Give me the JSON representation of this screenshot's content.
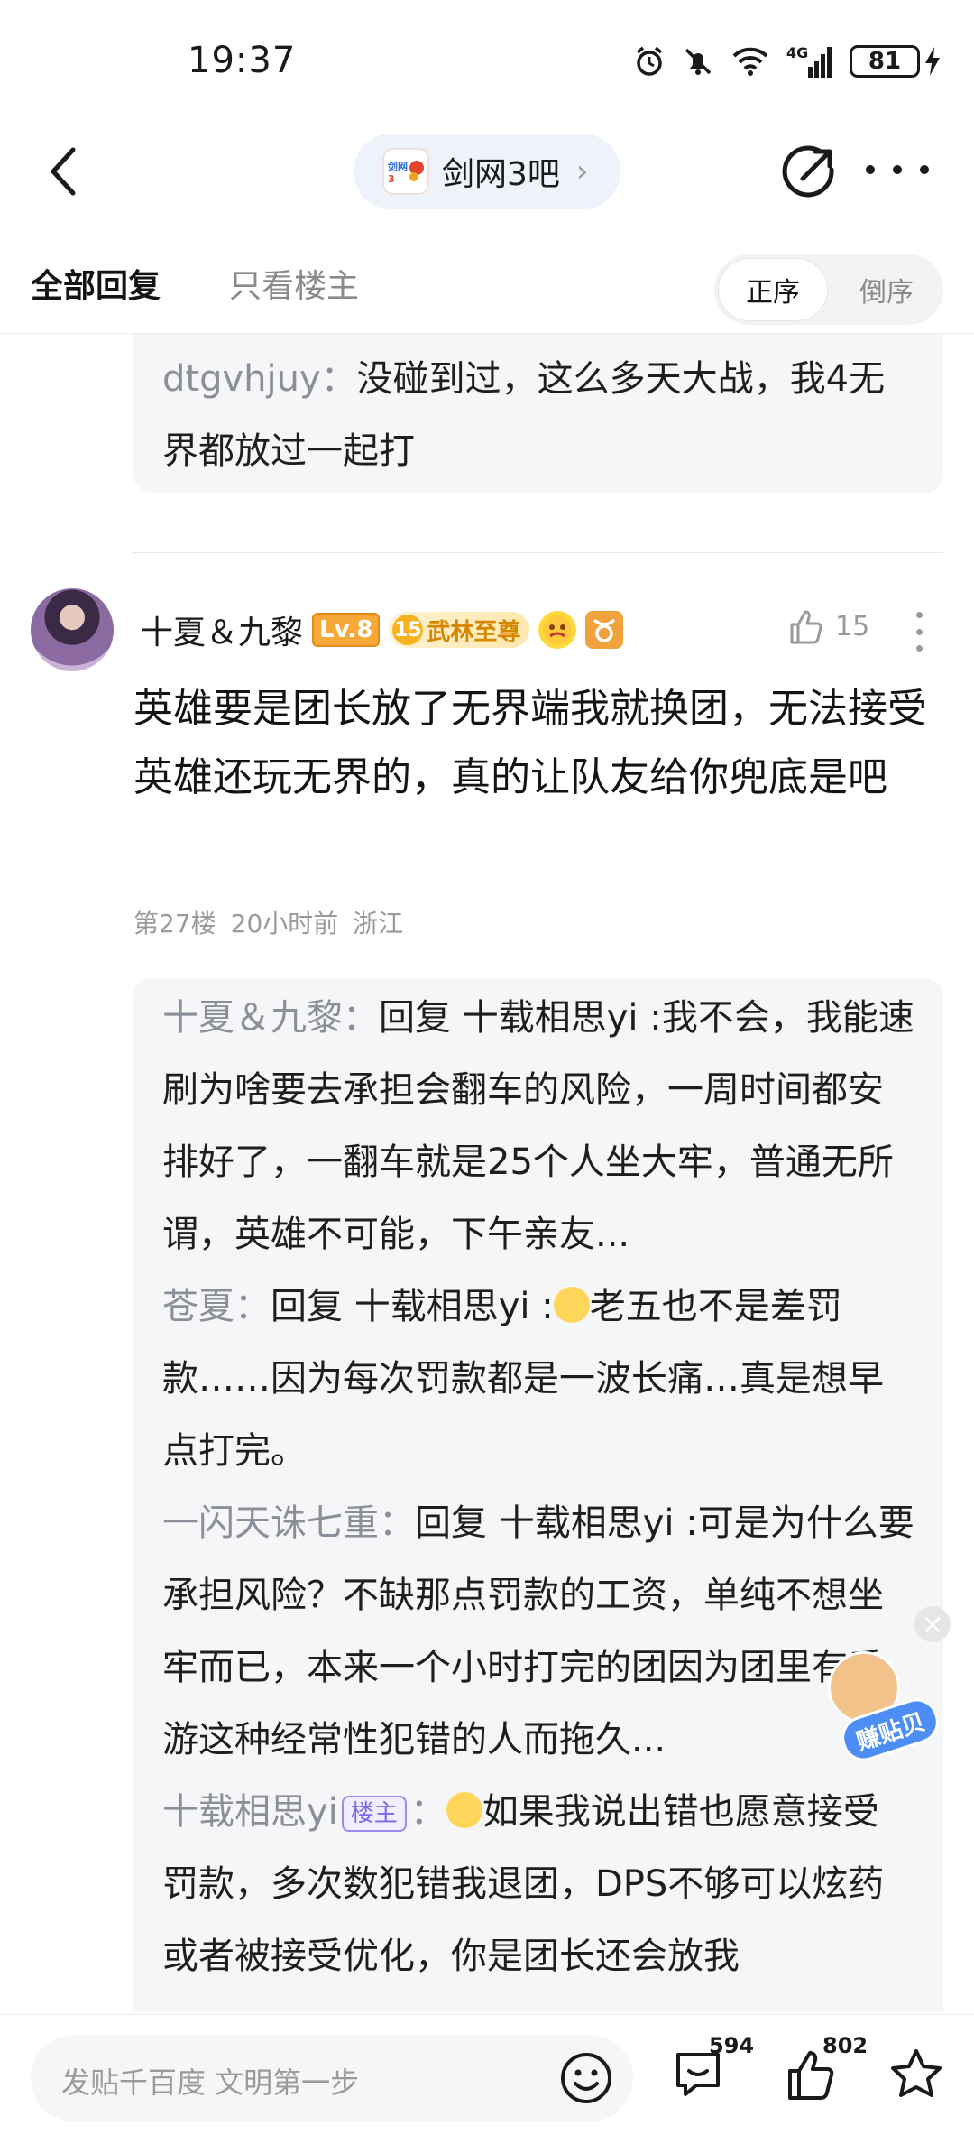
{
  "status_bar": {
    "time": "19:37",
    "network": "4G",
    "battery": "81"
  },
  "nav": {
    "forum_name": "剑网3吧",
    "forum_chevron": "›"
  },
  "tabs": {
    "all_replies": "全部回复",
    "op_only": "只看楼主",
    "order_asc": "正序",
    "order_desc": "倒序"
  },
  "prev_quote": {
    "username": "dtgvhjuy",
    "separator": "：",
    "text": "没碰到过，这么多天大战，我4无界都放过一起打"
  },
  "post": {
    "author": "十夏＆九黎",
    "level": "Lv.8",
    "title_badge_num": "15",
    "title_badge": "武林至尊",
    "like_count": "15",
    "body": "英雄要是团长放了无界端我就换团，无法接受英雄还玩无界的，真的让队友给你兜底是吧",
    "floor": "第27楼",
    "time": "20小时前",
    "location": "浙江"
  },
  "replies": [
    {
      "username": "十夏＆九黎",
      "sep": "：",
      "text": "回复 十载相思yi :我不会，我能速刷为啥要去承担会翻车的风险，一周时间都安排好了，一翻车就是25个人坐大牢，普通无所谓，英雄不可能，下午亲友..."
    },
    {
      "username": "苍夏",
      "sep": "：",
      "text_before": "回复 十载相思yi :",
      "text_after": "老五也不是差罚款……因为每次罚款都是一波长痛…真是想早点打完。"
    },
    {
      "username": "一闪天诛七重",
      "sep": "：",
      "text": "回复 十载相思yi :可是为什么要承担风险？不缺那点罚款的工资，单纯不想坐牢而已，本来一个小时打完的团因为团里有手游这种经常性犯错的人而拖久..."
    },
    {
      "username": "十载相思yi",
      "op_tag": "楼主",
      "sep": "：",
      "text": "如果我说出错也愿意接受罚款，多次数犯错我退团，DPS不够可以炫药或者被接受优化，你是团长还会放我"
    }
  ],
  "float_widget": {
    "label": "赚贴贝"
  },
  "bottom": {
    "input_placeholder": "发贴千百度 文明第一步",
    "comment_count": "594",
    "like_count": "802"
  },
  "colors": {
    "accent_blue": "#4c8df6",
    "username_grey": "#8c8f99",
    "level_orange": "#f6a938",
    "op_purple": "#7b68ee"
  },
  "icons": [
    "back-icon",
    "share-icon",
    "more-icon",
    "thumbs-up-icon",
    "emoji-icon",
    "comment-icon",
    "star-icon",
    "alarm-icon",
    "mute-icon",
    "wifi-icon",
    "signal-icon",
    "battery-icon",
    "charging-icon"
  ]
}
